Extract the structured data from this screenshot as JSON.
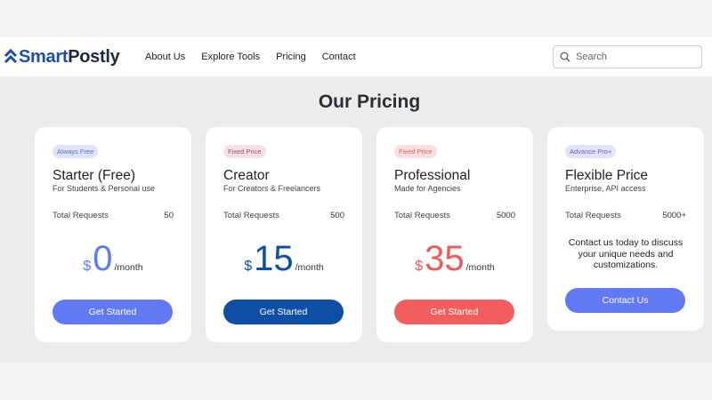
{
  "brand": {
    "name_part1": "Smart",
    "name_part2": "Postly"
  },
  "nav": {
    "items": [
      "About Us",
      "Explore Tools",
      "Pricing",
      "Contact"
    ]
  },
  "search": {
    "placeholder": "Search"
  },
  "section": {
    "title": "Our Pricing"
  },
  "plans": [
    {
      "badge": "Always Free",
      "name": "Starter (Free)",
      "subtitle": "For Students & Personal use",
      "requests_label": "Total Requests",
      "requests_value": "50",
      "currency": "$",
      "price": "0",
      "per": "/month",
      "button": "Get Started"
    },
    {
      "badge": "Fixed Price",
      "name": "Creator",
      "subtitle": "For Creators & Freelancers",
      "requests_label": "Total Requests",
      "requests_value": "500",
      "currency": "$",
      "price": "15",
      "per": "/month",
      "button": "Get Started"
    },
    {
      "badge": "Fixed Price",
      "name": "Professional",
      "subtitle": "Made for Agencies",
      "requests_label": "Total Requests",
      "requests_value": "5000",
      "currency": "$",
      "price": "35",
      "per": "/month",
      "button": "Get Started"
    },
    {
      "badge": "Advance Pro+",
      "name": "Flexible Price",
      "subtitle": "Enterprise, API access",
      "requests_label": "Total Requests",
      "requests_value": "5000+",
      "contact_text": "Contact us today to discuss your unique needs and customizations.",
      "button": "Contact Us"
    }
  ],
  "colors": {
    "primary_blue": "#6179f2",
    "navy": "#0e4fa6",
    "red": "#f25d5d",
    "brand": "#1c4fa8"
  }
}
